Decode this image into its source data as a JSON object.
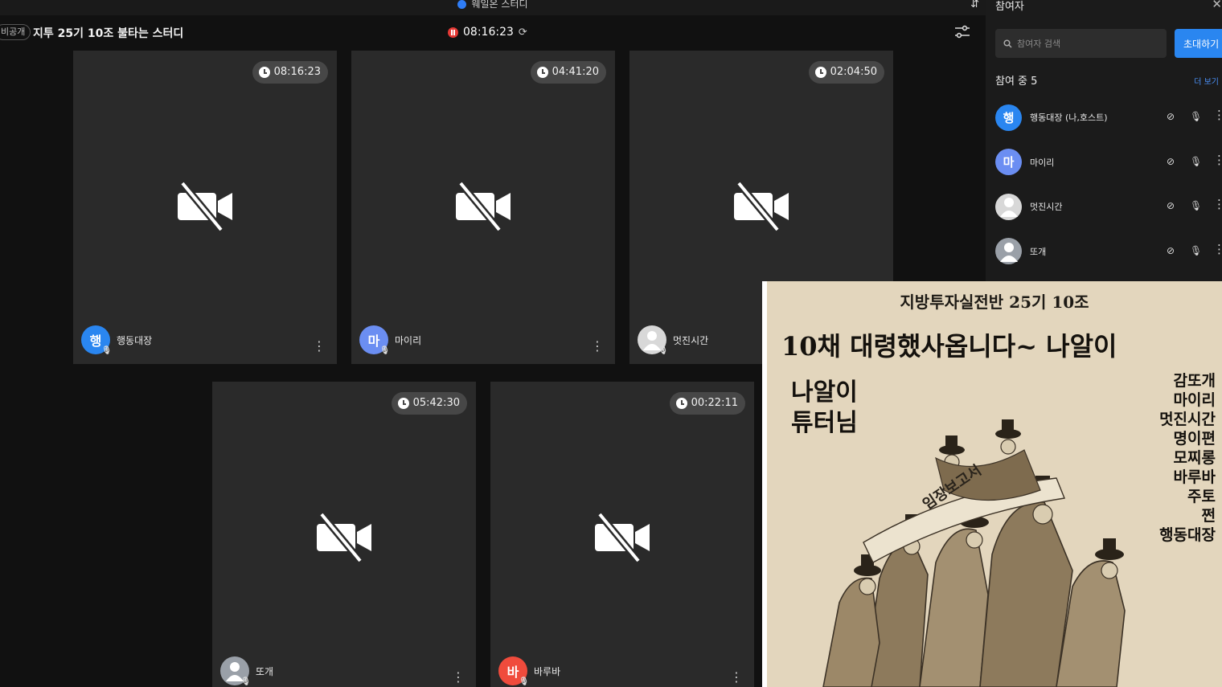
{
  "topbar": {
    "room_name": "웨일온 스터디"
  },
  "study": {
    "privacy_badge": "비공개",
    "title": "지투 25기 10조 불타는 스터디",
    "elapsed": "08:16:23"
  },
  "tiles": [
    {
      "name": "행동대장",
      "avatar": "행",
      "color": "#2a86f0",
      "timer": "08:16:23"
    },
    {
      "name": "마이리",
      "avatar": "마",
      "color": "#6b8ef2",
      "timer": "04:41:20"
    },
    {
      "name": "멋진시간",
      "avatar": "",
      "color": "#d8d8d8",
      "timer": "02:04:50"
    },
    {
      "name": "또개",
      "avatar": "",
      "color": "#9aa0a8",
      "timer": "05:42:30"
    },
    {
      "name": "바루바",
      "avatar": "바",
      "color": "#f04b3c",
      "timer": "00:22:11"
    }
  ],
  "panel": {
    "title": "참여자",
    "search_placeholder": "참여자 검색",
    "invite_label": "초대하기",
    "count_label": "참여 중 5",
    "more_label": "더 보기",
    "participants": [
      {
        "name": "행동대장 (나,호스트)",
        "avatar": "행",
        "color": "#2a86f0"
      },
      {
        "name": "마이리",
        "avatar": "마",
        "color": "#6b8ef2"
      },
      {
        "name": "멋진시간",
        "avatar": "",
        "color": "#d8d8d8"
      },
      {
        "name": "또개",
        "avatar": "",
        "color": "#9aa0a8"
      }
    ]
  },
  "shared_image": {
    "heading": "지방투자실전반 25기 10조",
    "banner": "10채 대령했사옵니다~ 나알이",
    "left_lines": [
      "나알이",
      "튜터님"
    ],
    "right_lines": [
      "감또개",
      "마이리",
      "멋진시간",
      "명이편",
      "모찌롱",
      "바루바",
      "주토",
      "쩐",
      "행동대장"
    ],
    "scroll_text": "임장보고서"
  }
}
